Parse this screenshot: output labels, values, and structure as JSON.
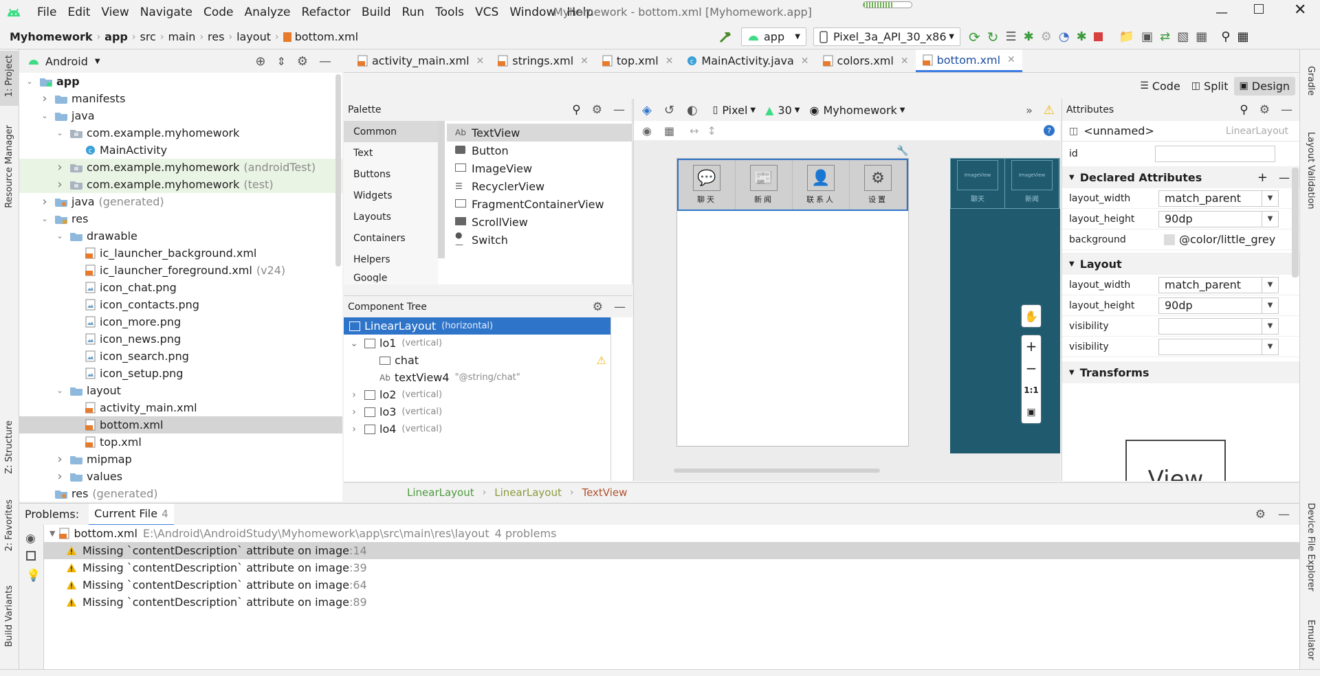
{
  "menu": [
    "File",
    "Edit",
    "View",
    "Navigate",
    "Code",
    "Analyze",
    "Refactor",
    "Build",
    "Run",
    "Tools",
    "VCS",
    "Window",
    "Help"
  ],
  "window_title": "Myhomework - bottom.xml [Myhomework.app]",
  "breadcrumb": [
    "Myhomework",
    "app",
    "src",
    "main",
    "res",
    "layout",
    "bottom.xml"
  ],
  "run_config": "app",
  "device": "Pixel_3a_API_30_x86",
  "left_strip": [
    "1: Project",
    "Resource Manager",
    "Z: Structure",
    "2: Favorites",
    "Build Variants"
  ],
  "right_strip": [
    "Gradle",
    "Layout Validation",
    "Device File Explorer",
    "Emulator"
  ],
  "project_view": "Android",
  "tree": [
    {
      "label": "app",
      "depth": 0,
      "arrow": "open",
      "type": "folder-app",
      "bold": true
    },
    {
      "label": "manifests",
      "depth": 1,
      "arrow": "closed",
      "type": "folder"
    },
    {
      "label": "java",
      "depth": 1,
      "arrow": "open",
      "type": "folder"
    },
    {
      "label": "com.example.myhomework",
      "depth": 2,
      "arrow": "open",
      "type": "package"
    },
    {
      "label": "MainActivity",
      "depth": 3,
      "arrow": "none",
      "type": "class"
    },
    {
      "label": "com.example.myhomework",
      "suffix": "(androidTest)",
      "depth": 2,
      "arrow": "closed",
      "type": "package",
      "green": true
    },
    {
      "label": "com.example.myhomework",
      "suffix": "(test)",
      "depth": 2,
      "arrow": "closed",
      "type": "package",
      "green": true
    },
    {
      "label": "java",
      "suffix": "(generated)",
      "depth": 1,
      "arrow": "closed",
      "type": "folder-gen"
    },
    {
      "label": "res",
      "depth": 1,
      "arrow": "open",
      "type": "folder-res"
    },
    {
      "label": "drawable",
      "depth": 2,
      "arrow": "open",
      "type": "folder"
    },
    {
      "label": "ic_launcher_background.xml",
      "depth": 3,
      "arrow": "none",
      "type": "xml"
    },
    {
      "label": "ic_launcher_foreground.xml",
      "suffix": "(v24)",
      "depth": 3,
      "arrow": "none",
      "type": "xml"
    },
    {
      "label": "icon_chat.png",
      "depth": 3,
      "arrow": "none",
      "type": "png"
    },
    {
      "label": "icon_contacts.png",
      "depth": 3,
      "arrow": "none",
      "type": "png"
    },
    {
      "label": "icon_more.png",
      "depth": 3,
      "arrow": "none",
      "type": "png"
    },
    {
      "label": "icon_news.png",
      "depth": 3,
      "arrow": "none",
      "type": "png"
    },
    {
      "label": "icon_search.png",
      "depth": 3,
      "arrow": "none",
      "type": "png"
    },
    {
      "label": "icon_setup.png",
      "depth": 3,
      "arrow": "none",
      "type": "png"
    },
    {
      "label": "layout",
      "depth": 2,
      "arrow": "open",
      "type": "folder"
    },
    {
      "label": "activity_main.xml",
      "depth": 3,
      "arrow": "none",
      "type": "xml"
    },
    {
      "label": "bottom.xml",
      "depth": 3,
      "arrow": "none",
      "type": "xml",
      "selected": true
    },
    {
      "label": "top.xml",
      "depth": 3,
      "arrow": "none",
      "type": "xml"
    },
    {
      "label": "mipmap",
      "depth": 2,
      "arrow": "closed",
      "type": "folder"
    },
    {
      "label": "values",
      "depth": 2,
      "arrow": "closed",
      "type": "folder"
    },
    {
      "label": "res",
      "suffix": "(generated)",
      "depth": 1,
      "arrow": "none",
      "type": "folder-gen"
    }
  ],
  "tabs": [
    {
      "label": "activity_main.xml",
      "type": "xml"
    },
    {
      "label": "strings.xml",
      "type": "xml"
    },
    {
      "label": "top.xml",
      "type": "xml"
    },
    {
      "label": "MainActivity.java",
      "type": "class"
    },
    {
      "label": "colors.xml",
      "type": "xml"
    },
    {
      "label": "bottom.xml",
      "type": "xml",
      "active": true
    }
  ],
  "modes": [
    "Code",
    "Split",
    "Design"
  ],
  "palette": {
    "title": "Palette",
    "categories": [
      "Common",
      "Text",
      "Buttons",
      "Widgets",
      "Layouts",
      "Containers",
      "Helpers",
      "Google"
    ],
    "items": [
      {
        "icon": "Ab",
        "label": "TextView"
      },
      {
        "icon": "btn",
        "label": "Button"
      },
      {
        "icon": "img",
        "label": "ImageView"
      },
      {
        "icon": "list",
        "label": "RecyclerView"
      },
      {
        "icon": "frag",
        "label": "FragmentContainerView"
      },
      {
        "icon": "scroll",
        "label": "ScrollView"
      },
      {
        "icon": "sw",
        "label": "Switch"
      }
    ]
  },
  "canvas_toolbar": {
    "device": "Pixel",
    "api": "30",
    "theme": "Myhomework"
  },
  "component_tree": {
    "title": "Component Tree",
    "nodes": [
      {
        "label": "LinearLayout",
        "meta": "(horizontal)",
        "depth": 0,
        "selected": true
      },
      {
        "label": "lo1",
        "meta": "(vertical)",
        "depth": 1,
        "arrow": "open"
      },
      {
        "label": "chat",
        "meta": "",
        "depth": 2,
        "icon": "img",
        "warn": true
      },
      {
        "label": "textView4",
        "meta": "\"@string/chat\"",
        "depth": 2,
        "icon": "Ab"
      },
      {
        "label": "lo2",
        "meta": "(vertical)",
        "depth": 1,
        "arrow": "closed"
      },
      {
        "label": "lo3",
        "meta": "(vertical)",
        "depth": 1,
        "arrow": "closed"
      },
      {
        "label": "lo4",
        "meta": "(vertical)",
        "depth": 1,
        "arrow": "closed"
      }
    ]
  },
  "preview": {
    "labels": [
      "聊天",
      "新闻",
      "联系人",
      "设置"
    ],
    "blueprint_labels": [
      "聊天",
      "新闻"
    ],
    "blueprint_hint": "ImageView",
    "zoom_reset": "1:1"
  },
  "attributes": {
    "title": "Attributes",
    "component": "<unnamed>",
    "component_type": "LinearLayout",
    "id_label": "id",
    "declared_title": "Declared Attributes",
    "declared": [
      {
        "key": "layout_width",
        "value": "match_parent"
      },
      {
        "key": "layout_height",
        "value": "90dp"
      },
      {
        "key": "background",
        "value": "@color/little_grey"
      }
    ],
    "layout_title": "Layout",
    "layout": [
      {
        "key": "layout_width",
        "value": "match_parent"
      },
      {
        "key": "layout_height",
        "value": "90dp"
      },
      {
        "key": "visibility",
        "value": ""
      },
      {
        "key": "visibility",
        "value": ""
      }
    ],
    "transforms_title": "Transforms",
    "transforms_preview": "View"
  },
  "design_breadcrumb": [
    "LinearLayout",
    "LinearLayout",
    "TextView"
  ],
  "problems": {
    "title": "Problems:",
    "tab": "Current File",
    "count": "4",
    "file": "bottom.xml",
    "path": "E:\\Android\\AndroidStudy\\Myhomework\\app\\src\\main\\res\\layout",
    "summary": "4 problems",
    "items": [
      {
        "text": "Missing `contentDescription` attribute on image",
        "line": ":14"
      },
      {
        "text": "Missing `contentDescription` attribute on image",
        "line": ":39"
      },
      {
        "text": "Missing `contentDescription` attribute on image",
        "line": ":64"
      },
      {
        "text": "Missing `contentDescription` attribute on image",
        "line": ":89"
      }
    ]
  },
  "colors": {
    "accent": "#3b7ce0",
    "android_green": "#3ddc84",
    "selection": "#2e74c9",
    "blueprint": "#1f5a6e",
    "warning": "#f0b400"
  }
}
